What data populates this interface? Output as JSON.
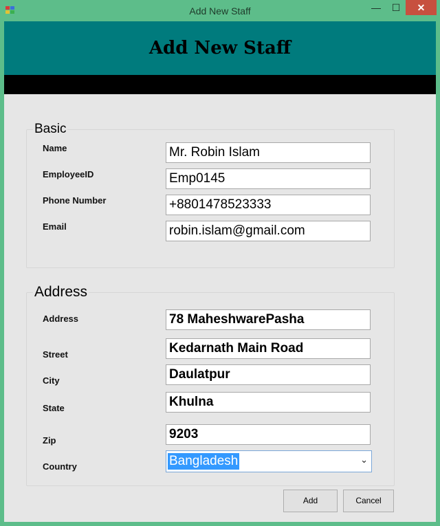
{
  "window": {
    "title": "Add New Staff",
    "minimize_symbol": "—",
    "maximize_symbol": "☐",
    "close_symbol": "✕"
  },
  "header": {
    "title": "Add New Staff"
  },
  "basic": {
    "legend": "Basic",
    "name_label": "Name",
    "name_value": "Mr. Robin Islam",
    "employee_id_label": "EmployeeID",
    "employee_id_value": "Emp0145",
    "phone_label": "Phone Number",
    "phone_value": "+8801478523333",
    "email_label": "Email",
    "email_value": "robin.islam@gmail.com"
  },
  "address": {
    "legend": "Address",
    "address_label": "Address",
    "address_value": "78 MaheshwarePasha",
    "street_label": "Street",
    "street_value": "Kedarnath Main Road",
    "city_label": "City",
    "city_value": "Daulatpur",
    "state_label": "State",
    "state_value": "Khulna",
    "zip_label": "Zip",
    "zip_value": "9203",
    "country_label": "Country",
    "country_value": "Bangladesh"
  },
  "buttons": {
    "add": "Add",
    "cancel": "Cancel"
  },
  "colors": {
    "window_frame": "#5dbd8a",
    "header_bg": "#007b7d",
    "close_button": "#c7503f",
    "selection": "#3399ff"
  },
  "icons": {
    "app": "winforms-app-icon",
    "dropdown": "chevron-down-icon"
  }
}
